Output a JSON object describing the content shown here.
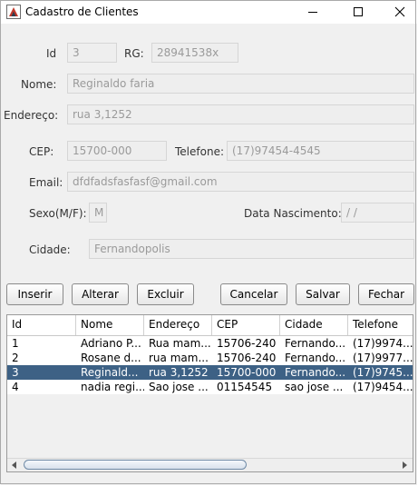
{
  "window": {
    "title": "Cadastro de Clientes"
  },
  "form": {
    "id": {
      "label": "Id",
      "value": "3"
    },
    "rg": {
      "label": "RG:",
      "value": "28941538x"
    },
    "nome": {
      "label": "Nome:",
      "value": "Reginaldo faria"
    },
    "endereco": {
      "label": "Endereço:",
      "value": "rua 3,1252"
    },
    "cep": {
      "label": "CEP:",
      "value": "15700-000"
    },
    "telefone": {
      "label": "Telefone:",
      "value": "(17)97454-4545"
    },
    "email": {
      "label": "Email:",
      "value": "dfdfadsfasfasf@gmail.com"
    },
    "sexo": {
      "label": "Sexo(M/F):",
      "value": "M"
    },
    "nascimento": {
      "label": "Data Nascimento:",
      "value": " / /"
    },
    "cidade": {
      "label": "Cidade:",
      "value": "Fernandopolis"
    }
  },
  "buttons": {
    "inserir": "Inserir",
    "alterar": "Alterar",
    "excluir": "Excluir",
    "cancelar": "Cancelar",
    "salvar": "Salvar",
    "fechar": "Fechar"
  },
  "table": {
    "columns": [
      "Id",
      "Nome",
      "Endereço",
      "CEP",
      "Cidade",
      "Telefone"
    ],
    "rows": [
      [
        "1",
        "Adriano P...",
        "Rua mam...",
        "15706-240",
        "Fernando...",
        "(17)9974..."
      ],
      [
        "2",
        "Rosane d...",
        "rua mam...",
        "15706-240",
        "Fernando...",
        "(17)9977..."
      ],
      [
        "3",
        "Reginald...",
        "rua 3,1252",
        "15700-000",
        "Fernando...",
        "(17)9745..."
      ],
      [
        "4",
        "nadia regi...",
        "Sao jose ...",
        "01154545",
        "sao jose ...",
        "(17)9454..."
      ]
    ],
    "selected_row": "3"
  },
  "colors": {
    "selection": "#3d6185",
    "background": "#f0f0f0"
  },
  "icons": [
    "app-icon",
    "minimize-icon",
    "maximize-icon",
    "close-icon",
    "scroll-left-icon",
    "scroll-right-icon"
  ]
}
